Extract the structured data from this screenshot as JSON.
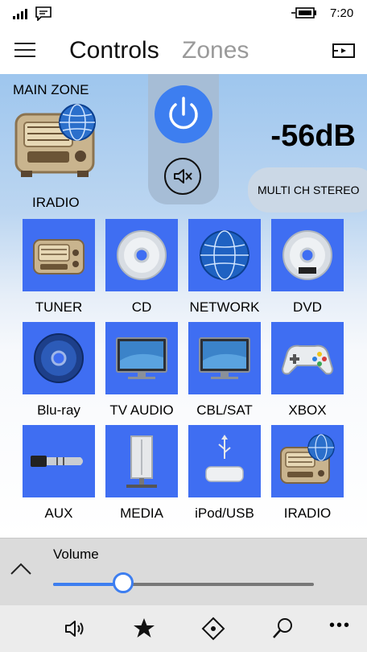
{
  "status_bar": {
    "time": "7:20"
  },
  "app_bar": {
    "tabs": [
      "Controls",
      "Zones"
    ],
    "active_tab": "Controls"
  },
  "zone": {
    "title": "MAIN ZONE",
    "source": "IRADIO",
    "volume_db": "-56dB",
    "surround_mode": "MULTI CH STEREO"
  },
  "sources": [
    {
      "label": "TUNER",
      "icon": "radio-icon"
    },
    {
      "label": "CD",
      "icon": "cd-icon"
    },
    {
      "label": "NETWORK",
      "icon": "globe-icon"
    },
    {
      "label": "DVD",
      "icon": "dvd-icon"
    },
    {
      "label": "Blu-ray",
      "icon": "bluray-icon"
    },
    {
      "label": "TV AUDIO",
      "icon": "tv-icon"
    },
    {
      "label": "CBL/SAT",
      "icon": "tv-icon"
    },
    {
      "label": "XBOX",
      "icon": "gamepad-icon"
    },
    {
      "label": "AUX",
      "icon": "audio-jack-icon"
    },
    {
      "label": "MEDIA",
      "icon": "media-server-icon"
    },
    {
      "label": "iPod/USB",
      "icon": "usb-icon"
    },
    {
      "label": "IRADIO",
      "icon": "internet-radio-icon"
    }
  ],
  "volume": {
    "label": "Volume",
    "level_fraction": 0.27
  },
  "colors": {
    "accent": "#3d7ef0",
    "tile": "#3f6ef2",
    "inactive_tab": "#9a9a9a"
  },
  "bottom_bar": {
    "icons": [
      "speaker-icon",
      "star-icon",
      "navigate-icon",
      "search-icon",
      "more-icon"
    ]
  }
}
